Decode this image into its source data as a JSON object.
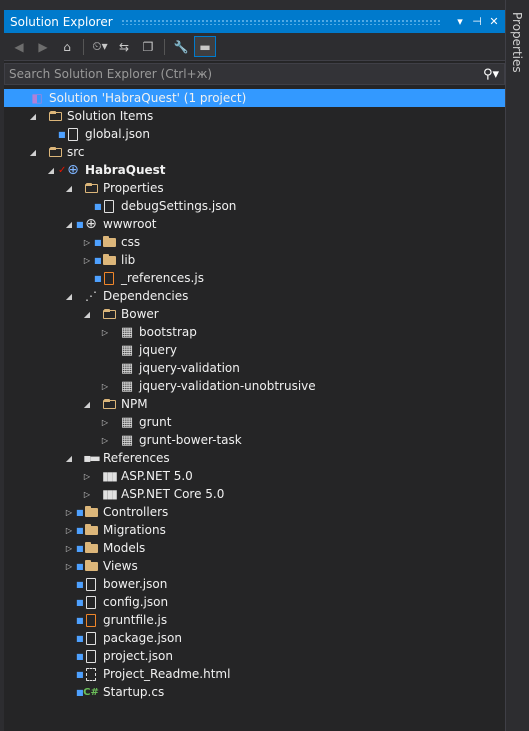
{
  "window": {
    "title": "Solution Explorer",
    "pin_label": "▾",
    "autohide_label": "⊣",
    "close_label": "✕"
  },
  "side_tab": {
    "label": "Properties"
  },
  "search": {
    "placeholder": "Search Solution Explorer (Ctrl+ж)"
  },
  "toolbar": {
    "buttons": [
      "back-icon",
      "forward-icon",
      "home-icon",
      "history-icon",
      "sync-icon",
      "collapse-all-icon",
      "properties-icon",
      "preview-icon"
    ]
  },
  "tree": [
    {
      "label": "Solution 'HabraQuest' (1 project)",
      "depth": 0,
      "icon": "solution",
      "expander": "",
      "selected": true
    },
    {
      "label": "Solution Items",
      "depth": 1,
      "icon": "folder-open",
      "expander": "◢"
    },
    {
      "label": "global.json",
      "depth": 2,
      "icon": "file",
      "expander": "",
      "lock": true
    },
    {
      "label": "src",
      "depth": 1,
      "icon": "folder-open",
      "expander": "◢"
    },
    {
      "label": "HabraQuest",
      "depth": 2,
      "icon": "web-project",
      "expander": "◢",
      "bold": true,
      "check": true
    },
    {
      "label": "Properties",
      "depth": 3,
      "icon": "folder-open",
      "expander": "◢"
    },
    {
      "label": "debugSettings.json",
      "depth": 4,
      "icon": "file",
      "expander": "",
      "lock": true
    },
    {
      "label": "wwwroot",
      "depth": 3,
      "icon": "globe",
      "expander": "◢",
      "lock": true
    },
    {
      "label": "css",
      "depth": 4,
      "icon": "folder",
      "expander": "▷",
      "lock": true
    },
    {
      "label": "lib",
      "depth": 4,
      "icon": "folder",
      "expander": "▷",
      "lock": true
    },
    {
      "label": "_references.js",
      "depth": 4,
      "icon": "file-js",
      "expander": "",
      "lock": true
    },
    {
      "label": "Dependencies",
      "depth": 3,
      "icon": "dependencies",
      "expander": "◢"
    },
    {
      "label": "Bower",
      "depth": 4,
      "icon": "folder-open",
      "expander": "◢"
    },
    {
      "label": "bootstrap",
      "depth": 5,
      "icon": "package",
      "expander": "▷"
    },
    {
      "label": "jquery",
      "depth": 5,
      "icon": "package",
      "expander": ""
    },
    {
      "label": "jquery-validation",
      "depth": 5,
      "icon": "package",
      "expander": ""
    },
    {
      "label": "jquery-validation-unobtrusive",
      "depth": 5,
      "icon": "package",
      "expander": "▷"
    },
    {
      "label": "NPM",
      "depth": 4,
      "icon": "folder-open",
      "expander": "◢"
    },
    {
      "label": "grunt",
      "depth": 5,
      "icon": "package",
      "expander": "▷"
    },
    {
      "label": "grunt-bower-task",
      "depth": 5,
      "icon": "package",
      "expander": "▷"
    },
    {
      "label": "References",
      "depth": 3,
      "icon": "references",
      "expander": "◢"
    },
    {
      "label": "ASP.NET 5.0",
      "depth": 4,
      "icon": "assembly",
      "expander": "▷"
    },
    {
      "label": "ASP.NET Core 5.0",
      "depth": 4,
      "icon": "assembly",
      "expander": "▷"
    },
    {
      "label": "Controllers",
      "depth": 3,
      "icon": "folder",
      "expander": "▷",
      "lock": true
    },
    {
      "label": "Migrations",
      "depth": 3,
      "icon": "folder",
      "expander": "▷",
      "lock": true
    },
    {
      "label": "Models",
      "depth": 3,
      "icon": "folder",
      "expander": "▷",
      "lock": true
    },
    {
      "label": "Views",
      "depth": 3,
      "icon": "folder",
      "expander": "▷",
      "lock": true
    },
    {
      "label": "bower.json",
      "depth": 3,
      "icon": "file",
      "expander": "",
      "lock": true
    },
    {
      "label": "config.json",
      "depth": 3,
      "icon": "file",
      "expander": "",
      "lock": true
    },
    {
      "label": "gruntfile.js",
      "depth": 3,
      "icon": "file-js",
      "expander": "",
      "lock": true
    },
    {
      "label": "package.json",
      "depth": 3,
      "icon": "file",
      "expander": "",
      "lock": true
    },
    {
      "label": "project.json",
      "depth": 3,
      "icon": "file",
      "expander": "",
      "lock": true
    },
    {
      "label": "Project_Readme.html",
      "depth": 3,
      "icon": "file-html",
      "expander": "",
      "lock": true
    },
    {
      "label": "Startup.cs",
      "depth": 3,
      "icon": "csharp",
      "expander": "",
      "lock": true
    }
  ]
}
